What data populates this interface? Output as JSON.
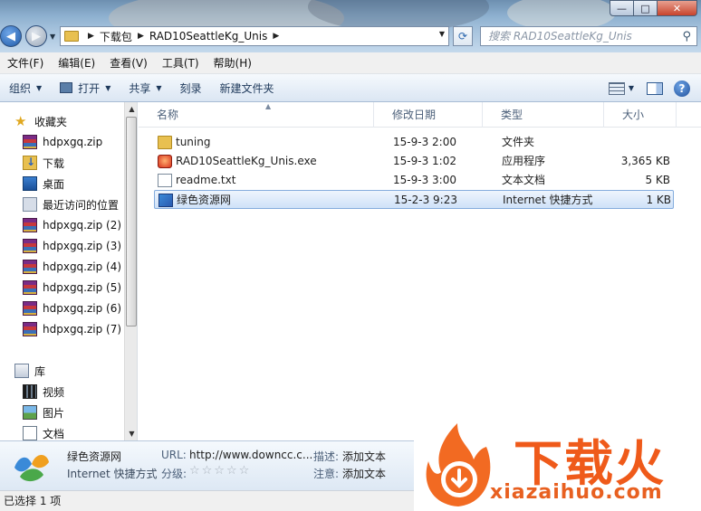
{
  "window": {
    "min_label": "—",
    "max_label": "□",
    "close_label": "✕"
  },
  "address": {
    "crumbs": [
      "下载包",
      "RAD10SeattleKg_Unis"
    ]
  },
  "search": {
    "placeholder": "搜索 RAD10SeattleKg_Unis"
  },
  "menu": [
    "文件(F)",
    "编辑(E)",
    "查看(V)",
    "工具(T)",
    "帮助(H)"
  ],
  "toolbar": {
    "organize": "组织",
    "open": "打开",
    "share": "共享",
    "burn": "刻录",
    "new_folder": "新建文件夹",
    "help_label": "?"
  },
  "sidebar": {
    "favorites": "收藏夹",
    "items": [
      {
        "label": "hdpxgq.zip",
        "icon": "zip-icon"
      },
      {
        "label": "下载",
        "icon": "downloads-icon"
      },
      {
        "label": "桌面",
        "icon": "desktop-icon"
      },
      {
        "label": "最近访问的位置",
        "icon": "recent-icon"
      },
      {
        "label": "hdpxgq.zip (2)",
        "icon": "zip-icon"
      },
      {
        "label": "hdpxgq.zip (3)",
        "icon": "zip-icon"
      },
      {
        "label": "hdpxgq.zip (4)",
        "icon": "zip-icon"
      },
      {
        "label": "hdpxgq.zip (5)",
        "icon": "zip-icon"
      },
      {
        "label": "hdpxgq.zip (6)",
        "icon": "zip-icon"
      },
      {
        "label": "hdpxgq.zip (7)",
        "icon": "zip-icon"
      }
    ],
    "library": "库",
    "library_items": [
      {
        "label": "视频",
        "icon": "video-icon"
      },
      {
        "label": "图片",
        "icon": "pictures-icon"
      },
      {
        "label": "文档",
        "icon": "documents-icon"
      }
    ]
  },
  "columns": {
    "name": "名称",
    "modified": "修改日期",
    "type": "类型",
    "size": "大小"
  },
  "files": [
    {
      "name": "tuning",
      "modified": "15-9-3 2:00",
      "type": "文件夹",
      "size": "",
      "icon": "folder-icon",
      "selected": false
    },
    {
      "name": "RAD10SeattleKg_Unis.exe",
      "modified": "15-9-3 1:02",
      "type": "应用程序",
      "size": "3,365 KB",
      "icon": "exe-icon",
      "selected": false
    },
    {
      "name": "readme.txt",
      "modified": "15-9-3 3:00",
      "type": "文本文档",
      "size": "5 KB",
      "icon": "text-file-icon",
      "selected": false
    },
    {
      "name": "绿色资源网",
      "modified": "15-2-3 9:23",
      "type": "Internet 快捷方式",
      "size": "1 KB",
      "icon": "internet-shortcut-icon",
      "selected": true
    }
  ],
  "details": {
    "title": "绿色资源网",
    "subtitle": "Internet 快捷方式",
    "url_label": "URL:",
    "url_value": "http://www.downcc.c...",
    "rating_label": "分级:",
    "rating_stars": "☆☆☆☆☆",
    "desc_label": "描述:",
    "desc_value": "添加文本",
    "note_label": "注意:",
    "note_value": "添加文本"
  },
  "status": {
    "text": "已选择 1 项"
  },
  "watermark": {
    "main": "下载火",
    "sub": "xiazaihuo.com"
  },
  "colors": {
    "accent": "#1f5aa8",
    "selection": "#cfe2f8",
    "watermark": "#ef5a1a"
  }
}
